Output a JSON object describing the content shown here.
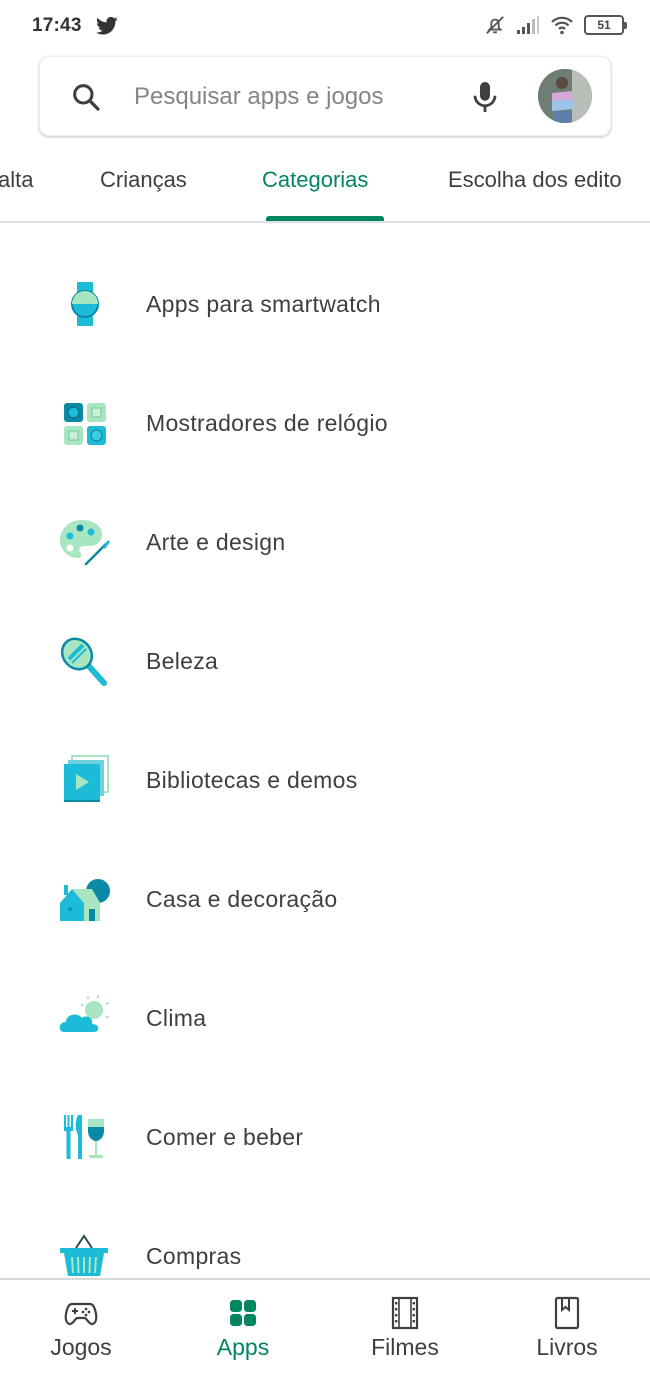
{
  "status_bar": {
    "time": "17:43",
    "notification_icon": "twitter-icon",
    "icons": [
      "bell-off-icon",
      "signal-icon",
      "wifi-icon",
      "battery-icon"
    ],
    "battery_level": "51"
  },
  "search": {
    "placeholder": "Pesquisar apps e jogos",
    "search_icon": "search-icon",
    "mic_icon": "mic-icon",
    "avatar": "user-avatar"
  },
  "tabs": [
    {
      "label": "alta",
      "active": false
    },
    {
      "label": "Crianças",
      "active": false
    },
    {
      "label": "Categorias",
      "active": true
    },
    {
      "label": "Escolha dos edito",
      "active": false
    }
  ],
  "categories": [
    {
      "label": "Apps para smartwatch",
      "icon": "smartwatch-icon"
    },
    {
      "label": "Mostradores de relógio",
      "icon": "watch-faces-icon"
    },
    {
      "label": "Arte e design",
      "icon": "palette-icon"
    },
    {
      "label": "Beleza",
      "icon": "mirror-icon"
    },
    {
      "label": "Bibliotecas e demos",
      "icon": "libraries-play-icon"
    },
    {
      "label": "Casa e decoração",
      "icon": "house-icon"
    },
    {
      "label": "Clima",
      "icon": "weather-icon"
    },
    {
      "label": "Comer e beber",
      "icon": "food-drink-icon"
    },
    {
      "label": "Compras",
      "icon": "shopping-basket-icon"
    }
  ],
  "bottom_nav": [
    {
      "label": "Jogos",
      "icon": "gamepad-icon",
      "active": false
    },
    {
      "label": "Apps",
      "icon": "apps-grid-icon",
      "active": true
    },
    {
      "label": "Filmes",
      "icon": "film-icon",
      "active": false
    },
    {
      "label": "Livros",
      "icon": "book-icon",
      "active": false
    }
  ],
  "colors": {
    "accent": "#01875f",
    "text": "#3c4043",
    "placeholder": "#80868b",
    "icon_cyan": "#1cbbd8",
    "icon_mint": "#a8e6c1",
    "icon_teal": "#0b8aa6"
  }
}
